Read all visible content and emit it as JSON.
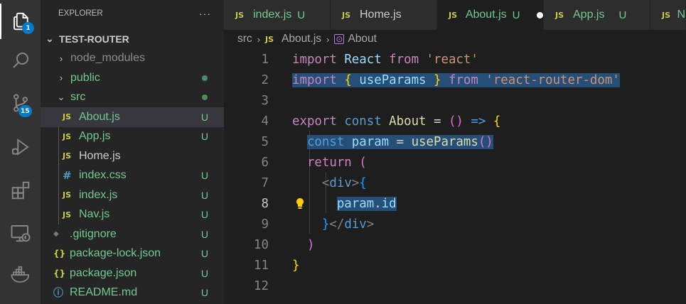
{
  "explorer": {
    "title": "EXPLORER",
    "more": "···",
    "project": "TEST-ROUTER",
    "items": [
      {
        "label": "node_modules",
        "kind": "folder",
        "twisty": "›",
        "status": ""
      },
      {
        "label": "public",
        "kind": "folder",
        "twisty": "›",
        "status": "dot"
      },
      {
        "label": "src",
        "kind": "folder-open",
        "twisty": "⌄",
        "status": "dot"
      },
      {
        "label": "About.js",
        "icon": "JS",
        "status": "U"
      },
      {
        "label": "App.js",
        "icon": "JS",
        "status": "U"
      },
      {
        "label": "Home.js",
        "icon": "JS",
        "status": ""
      },
      {
        "label": "index.css",
        "icon": "#",
        "status": "U"
      },
      {
        "label": "index.js",
        "icon": "JS",
        "status": "U"
      },
      {
        "label": "Nav.js",
        "icon": "JS",
        "status": "U"
      },
      {
        "label": ".gitignore",
        "icon": "◆",
        "status": "U"
      },
      {
        "label": "package-lock.json",
        "icon": "{}",
        "status": "U"
      },
      {
        "label": "package.json",
        "icon": "{}",
        "status": "U"
      },
      {
        "label": "README.md",
        "icon": "ⓘ",
        "status": "U"
      }
    ]
  },
  "activity": {
    "explorer_badge": "1",
    "scm_badge": "15"
  },
  "tabs": [
    {
      "icon": "JS",
      "label": "index.js",
      "status": "U"
    },
    {
      "icon": "JS",
      "label": "Home.js",
      "status": ""
    },
    {
      "icon": "JS",
      "label": "About.js",
      "status": "U"
    },
    {
      "icon": "JS",
      "label": "App.js",
      "status": "U"
    },
    {
      "icon": "JS",
      "label": "N",
      "status": ""
    }
  ],
  "breadcrumb": {
    "folder": "src",
    "file_icon": "JS",
    "file": "About.js",
    "symbol": "About"
  },
  "editor": {
    "line_numbers": [
      "1",
      "2",
      "3",
      "4",
      "5",
      "6",
      "7",
      "8",
      "9",
      "10",
      "11",
      "12"
    ],
    "current_line": "8"
  }
}
